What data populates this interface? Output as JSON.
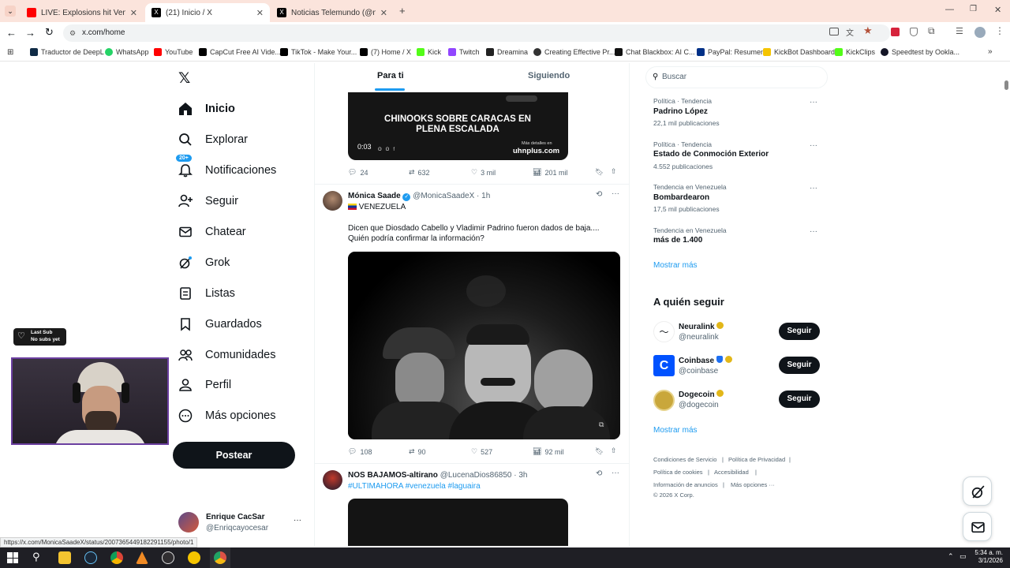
{
  "browser": {
    "tabs": [
      {
        "title": "LIVE: Explosions hit Venezuela's",
        "active": false,
        "favicon_color": "#ff0000"
      },
      {
        "title": "(21) Inicio / X",
        "active": true,
        "favicon_color": "#000000"
      },
      {
        "title": "Noticias Telemundo (@noticias",
        "active": false,
        "favicon_color": "#000000"
      }
    ],
    "url": "x.com/home",
    "bookmarks": [
      {
        "label": "Traductor de DeepL",
        "color": "#0f2b46"
      },
      {
        "label": "WhatsApp",
        "color": "#25d366"
      },
      {
        "label": "YouTube",
        "color": "#ff0000"
      },
      {
        "label": "CapCut Free AI Vide...",
        "color": "#000000"
      },
      {
        "label": "TikTok - Make Your...",
        "color": "#000000"
      },
      {
        "label": "(7) Home / X",
        "color": "#000000"
      },
      {
        "label": "Kick",
        "color": "#53fc18"
      },
      {
        "label": "Twitch",
        "color": "#9146ff"
      },
      {
        "label": "Dreamina",
        "color": "#222222"
      },
      {
        "label": "Creating Effective Pr...",
        "color": "#333333"
      },
      {
        "label": "Chat Blackbox: AI C...",
        "color": "#111111"
      },
      {
        "label": "PayPal: Resumen",
        "color": "#003087"
      },
      {
        "label": "KickBot Dashboard",
        "color": "#f5c400"
      },
      {
        "label": "KickClips",
        "color": "#53fc18"
      },
      {
        "label": "Speedtest by Ookla...",
        "color": "#141526"
      }
    ],
    "status_url": "https://x.com/MonicaSaadeX/status/2007365449182291155/photo/1"
  },
  "nav": {
    "items": [
      {
        "label": "Inicio",
        "icon": "home-icon"
      },
      {
        "label": "Explorar",
        "icon": "search-icon"
      },
      {
        "label": "Notificaciones",
        "icon": "bell-icon"
      },
      {
        "label": "Seguir",
        "icon": "person-add-icon"
      },
      {
        "label": "Chatear",
        "icon": "mail-icon"
      },
      {
        "label": "Grok",
        "icon": "grok-icon"
      },
      {
        "label": "Listas",
        "icon": "list-icon"
      },
      {
        "label": "Guardados",
        "icon": "bookmark-icon"
      },
      {
        "label": "Comunidades",
        "icon": "people-icon"
      },
      {
        "label": "Perfil",
        "icon": "person-icon"
      },
      {
        "label": "Más opciones",
        "icon": "more-circle-icon"
      }
    ],
    "notif_badge": "20+",
    "post_button": "Postear",
    "account": {
      "name": "Enrique CacSar",
      "handle": "@Enriqcayocesar"
    }
  },
  "feed": {
    "tabs": [
      "Para ti",
      "Siguiendo"
    ],
    "top_media": {
      "headline": "CHINOOKS SOBRE CARACAS EN PLENA ESCALADA",
      "time": "0:03",
      "more": "Más detalles en",
      "site": "uhnplus.com"
    },
    "top_stats": {
      "replies": "24",
      "reposts": "632",
      "likes": "3 mil",
      "views": "201 mil"
    },
    "post1": {
      "name": "Mónica Saade",
      "handle": "@MonicaSaadeX",
      "time": "· 1h",
      "flag_line": "VENEZUELA",
      "text1": "Dicen que Diosdado Cabello y Vladimir Padrino fueron dados de baja....",
      "text2": "Quién podría confirmar la información?",
      "stats": {
        "replies": "108",
        "reposts": "90",
        "likes": "527",
        "views": "92 mil"
      }
    },
    "post2": {
      "name": "NOS BAJAMOS-altirano",
      "handle": "@LucenaDios86850",
      "time": "· 3h",
      "hashtags": "#ULTIMAHORA #venezuela #laguaira"
    }
  },
  "sidebar": {
    "search_placeholder": "Buscar",
    "trends": [
      {
        "meta": "Política · Tendencia",
        "title": "Padrino López",
        "count": "22,1 mil publicaciones"
      },
      {
        "meta": "Política · Tendencia",
        "title": "Estado de Conmoción Exterior",
        "count": "4.552 publicaciones"
      },
      {
        "meta": "Tendencia en Venezuela",
        "title": "Bombardearon",
        "count": "17,5 mil publicaciones"
      },
      {
        "meta": "Tendencia en Venezuela",
        "title": "más de 1.400",
        "count": ""
      }
    ],
    "show_more": "Mostrar más",
    "who_to_follow_title": "A quién seguir",
    "accounts": [
      {
        "name": "Neuralink",
        "handle": "@neuralink",
        "button": "Seguir"
      },
      {
        "name": "Coinbase",
        "handle": "@coinbase",
        "button": "Seguir"
      },
      {
        "name": "Dogecoin",
        "handle": "@dogecoin",
        "button": "Seguir"
      }
    ],
    "footer": [
      "Condiciones de Servicio",
      "Política de Privacidad",
      "Política de cookies",
      "Accesibilidad",
      "Información de anuncios",
      "Más opciones ···",
      "© 2026 X Corp."
    ]
  },
  "overlay": {
    "sub_title": "Last Sub",
    "sub_text": "No subs yet"
  },
  "taskbar": {
    "time": "5:34 a. m.",
    "date": "3/1/2026"
  }
}
